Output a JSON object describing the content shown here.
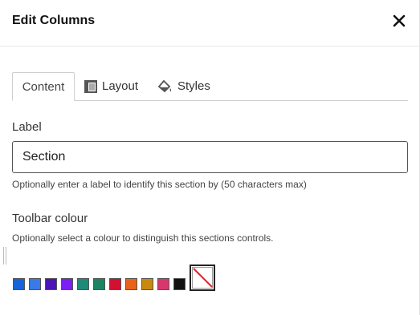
{
  "dialog": {
    "title": "Edit Columns",
    "close_icon": "close-icon"
  },
  "tabs": [
    {
      "label": "Content",
      "icon": "",
      "active": true
    },
    {
      "label": "Layout",
      "icon": "layout-icon",
      "active": false
    },
    {
      "label": "Styles",
      "icon": "paint-bucket-icon",
      "active": false
    }
  ],
  "label_field": {
    "heading": "Label",
    "value": "Section",
    "help": "Optionally enter a label to identify this section by (50 characters max)"
  },
  "toolbar_colour": {
    "heading": "Toolbar colour",
    "help": "Optionally select a colour to distinguish this sections controls.",
    "swatches": [
      "#1763d9",
      "#3a79e6",
      "#4b15b8",
      "#7b1ff2",
      "#1e8a78",
      "#1a8560",
      "#d3102f",
      "#e8621a",
      "#c88a0e",
      "#d8376e",
      "#111111"
    ],
    "none_icon": "no-colour-icon"
  }
}
